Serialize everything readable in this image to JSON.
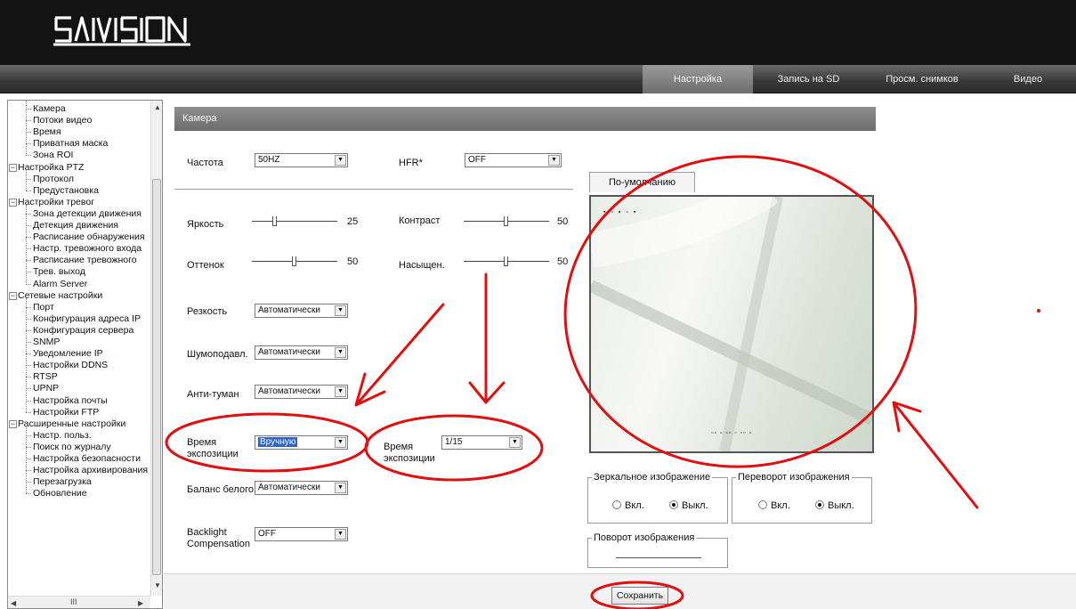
{
  "brand": {
    "logo_text": "SATVISION"
  },
  "nav": {
    "items": [
      "Настройка",
      "Запись на SD",
      "Просм. снимков",
      "Видео"
    ],
    "active_index": 0
  },
  "sidebar": {
    "items": [
      {
        "label": "Камера",
        "level": 2
      },
      {
        "label": "Потоки видео",
        "level": 2
      },
      {
        "label": "Время",
        "level": 2
      },
      {
        "label": "Приватная маска",
        "level": 2
      },
      {
        "label": "Зона ROI",
        "level": 2
      },
      {
        "label": "Настройка PTZ",
        "level": 1
      },
      {
        "label": "Протокол",
        "level": 2
      },
      {
        "label": "Предустановка",
        "level": 2
      },
      {
        "label": "Настройки тревог",
        "level": 1
      },
      {
        "label": "Зона детекции движения",
        "level": 2
      },
      {
        "label": "Детекция движения",
        "level": 2
      },
      {
        "label": "Расписание обнаружения",
        "level": 2
      },
      {
        "label": "Настр. тревожного входа",
        "level": 2
      },
      {
        "label": "Расписание тревожного",
        "level": 2
      },
      {
        "label": "Трев. выход",
        "level": 2
      },
      {
        "label": "Alarm Server",
        "level": 2
      },
      {
        "label": "Сетевые настройки",
        "level": 1
      },
      {
        "label": "Порт",
        "level": 2
      },
      {
        "label": "Конфигурация адреса IP",
        "level": 2
      },
      {
        "label": "Конфигурация сервера",
        "level": 2
      },
      {
        "label": "SNMP",
        "level": 2
      },
      {
        "label": "Уведомление IP",
        "level": 2
      },
      {
        "label": "Настройки DDNS",
        "level": 2
      },
      {
        "label": "RTSP",
        "level": 2
      },
      {
        "label": "UPNP",
        "level": 2
      },
      {
        "label": "Настройка почты",
        "level": 2
      },
      {
        "label": "Настройки FTP",
        "level": 2
      },
      {
        "label": "Расширенные настройки",
        "level": 1
      },
      {
        "label": "Настр. польз.",
        "level": 2
      },
      {
        "label": "Поиск по журналу",
        "level": 2
      },
      {
        "label": "Настройка безопасности",
        "level": 2
      },
      {
        "label": "Настройка архивирования",
        "level": 2
      },
      {
        "label": "Перезагрузка",
        "level": 2
      },
      {
        "label": "Обновление",
        "level": 2
      }
    ],
    "hscroll_glyph": "III"
  },
  "panel": {
    "title": "Камера"
  },
  "form": {
    "frequency": {
      "label": "Частота",
      "value": "50HZ"
    },
    "hfr": {
      "label": "HFR*",
      "value": "OFF"
    },
    "brightness": {
      "label": "Яркость",
      "value": 25,
      "max": 100
    },
    "contrast": {
      "label": "Контраст",
      "value": 50,
      "max": 100
    },
    "hue": {
      "label": "Оттенок",
      "value": 50,
      "max": 100
    },
    "saturation": {
      "label": "Насыщен.",
      "value": 50,
      "max": 100
    },
    "sharpness": {
      "label": "Резкость",
      "value": "Автоматически"
    },
    "noise": {
      "label": "Шумоподавл.",
      "value": "Автоматически"
    },
    "defog": {
      "label": "Анти-туман",
      "value": "Автоматически"
    },
    "exposure_mode": {
      "label": "Время экспозиции",
      "value": "Вручную"
    },
    "exposure_time": {
      "label": "Время экспозиции",
      "value": "1/15"
    },
    "white_balance": {
      "label": "Баланс белого",
      "value": "Автоматически"
    },
    "backlight": {
      "label": "Backlight Compensation",
      "value": "OFF"
    }
  },
  "preview": {
    "default_button": "По-умолчанию"
  },
  "mirror": {
    "legend": "Зеркальное изображение",
    "on": "Вкл.",
    "off": "Выкл.",
    "selected": "off"
  },
  "flip": {
    "legend": "Переворот изображения",
    "on": "Вкл.",
    "off": "Выкл.",
    "selected": "off"
  },
  "rotate": {
    "legend": "Поворот изображения"
  },
  "actions": {
    "save": "Сохранить"
  },
  "colors": {
    "header_bg": "#131313",
    "panel_title_bg": "#7d7d7d",
    "annotation_red": "#e01010",
    "selection_blue": "#2f63c8"
  }
}
